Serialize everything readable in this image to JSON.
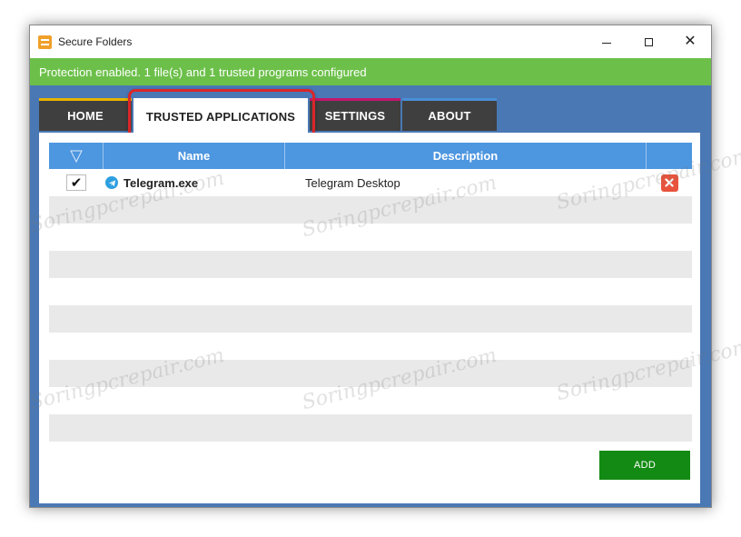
{
  "window": {
    "title": "Secure Folders",
    "controls": {
      "minimize": "",
      "maximize": "",
      "close": "✕"
    }
  },
  "status": {
    "text": "Protection enabled. 1 file(s) and 1 trusted programs configured",
    "color": "#6cc04a"
  },
  "tabs": [
    {
      "label": "HOME",
      "accent": "#e6b400"
    },
    {
      "label": "TRUSTED APPLICATIONS",
      "active": true
    },
    {
      "label": "SETTINGS",
      "accent": "#c2186b"
    },
    {
      "label": "ABOUT",
      "accent": "#4a8fd6"
    }
  ],
  "table": {
    "headers": {
      "check": "",
      "name": "Name",
      "description": "Description",
      "delete": ""
    },
    "rows": [
      {
        "checked": true,
        "check_glyph": "✔",
        "name": "Telegram.exe",
        "description": "Telegram Desktop",
        "icon": "telegram-icon"
      }
    ]
  },
  "buttons": {
    "add": "ADD"
  },
  "watermark": "Soringpcrepair.com",
  "colors": {
    "background": "#4a78b5",
    "header_blue": "#4d96e0",
    "tab_dark": "#3f3f3f",
    "add_green": "#138a13",
    "delete_red": "#e8533c",
    "highlight_red": "#d9262a"
  }
}
